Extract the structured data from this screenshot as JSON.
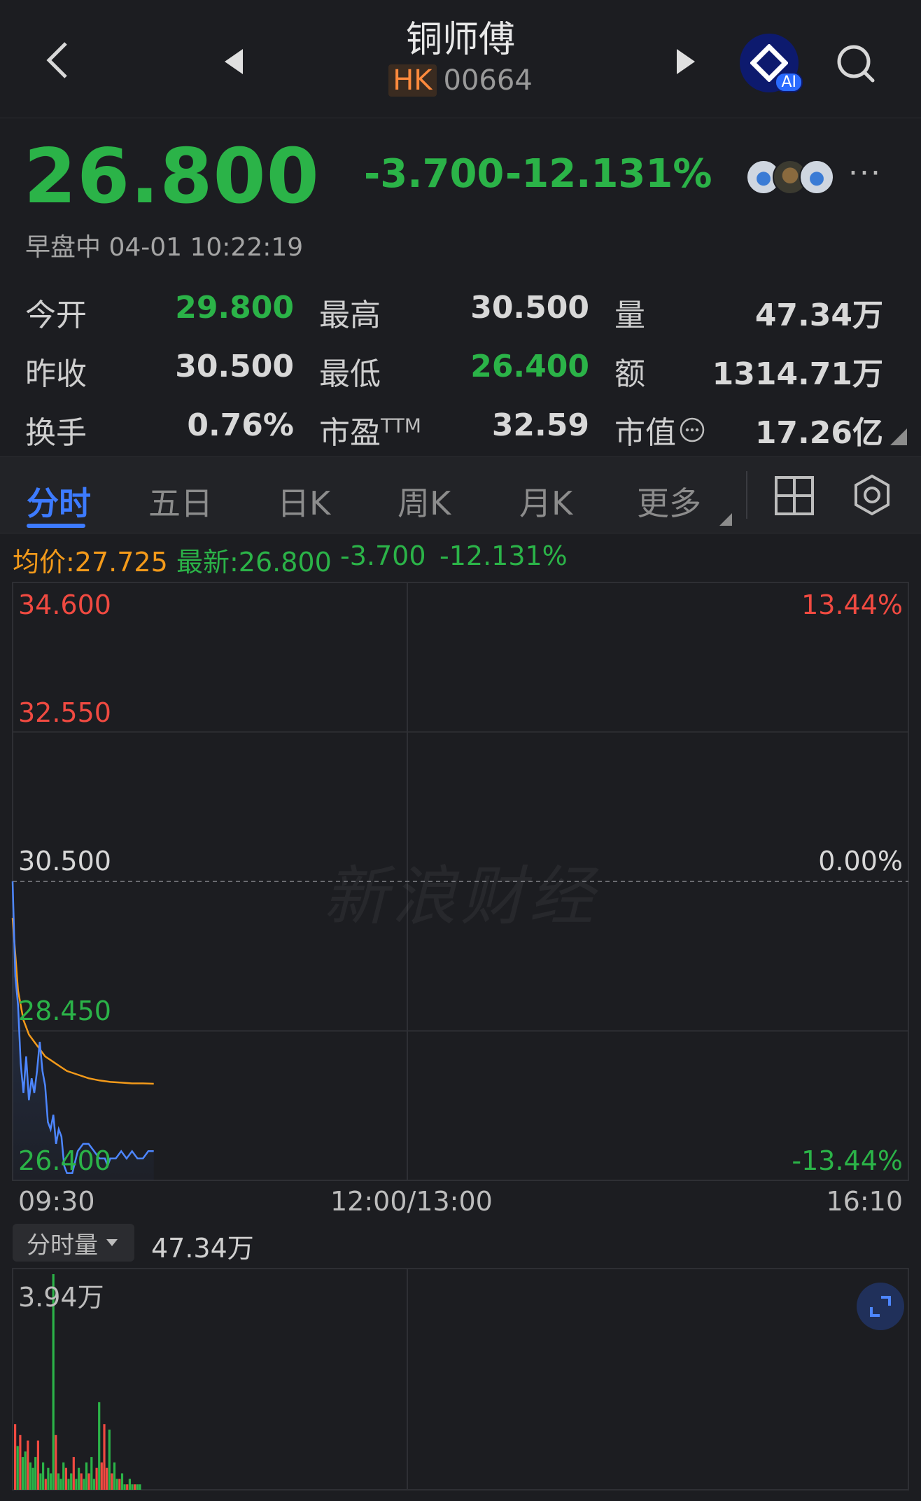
{
  "header": {
    "title": "铜师傅",
    "market": "HK",
    "code": "00664",
    "ai_label": "AI"
  },
  "quote": {
    "price": "26.800",
    "change": "-3.700",
    "change_pct": "-12.131%",
    "session_time": "早盘中 04-01 10:22:19",
    "more": "···"
  },
  "stats": {
    "open_label": "今开",
    "open_value": "29.800",
    "high_label": "最高",
    "high_value": "30.500",
    "volume_label": "量",
    "volume_value": "47.34万",
    "prev_close_label": "昨收",
    "prev_close_value": "30.500",
    "low_label": "最低",
    "low_value": "26.400",
    "amount_label": "额",
    "amount_value": "1314.71万",
    "turnover_label": "换手",
    "turnover_value": "0.76%",
    "pe_label": "市盈",
    "pe_sup": "TTM",
    "pe_value": "32.59",
    "mcap_label": "市值",
    "mcap_value": "17.26亿"
  },
  "tabs": [
    {
      "label": "分时"
    },
    {
      "label": "五日"
    },
    {
      "label": "日K"
    },
    {
      "label": "周K"
    },
    {
      "label": "月K"
    },
    {
      "label": "更多"
    }
  ],
  "info_line": {
    "avg": "均价:27.725",
    "latest": "最新:26.800",
    "change": "-3.700",
    "change_pct": "-12.131%"
  },
  "chart_data": [
    {
      "type": "line",
      "title": "",
      "x_ticks": [
        "09:30",
        "12:00/13:00",
        "16:10"
      ],
      "y_ticks": [
        "34.600",
        "32.550",
        "30.500",
        "28.450",
        "26.400"
      ],
      "y_right_ticks": [
        "13.44%",
        "0.00%",
        "-13.44%"
      ],
      "ylim": [
        26.4,
        34.6
      ],
      "reference_value": 30.5,
      "grid": true,
      "total_minutes": 330,
      "series": [
        {
          "name": "最新",
          "color": "#4d86ff",
          "x": [
            0,
            1,
            2,
            3,
            4,
            5,
            6,
            7,
            8,
            9,
            10,
            11,
            12,
            13,
            14,
            15,
            16,
            17,
            18,
            19,
            20,
            22,
            24,
            26,
            28,
            30,
            32,
            34,
            35,
            36,
            38,
            40,
            42,
            44,
            46,
            48,
            50,
            52
          ],
          "values": [
            30.5,
            29.2,
            28.8,
            28.0,
            27.6,
            28.1,
            27.5,
            27.8,
            27.6,
            27.9,
            28.3,
            27.9,
            27.7,
            27.2,
            27.1,
            27.3,
            26.9,
            27.1,
            27.0,
            26.6,
            26.5,
            26.5,
            26.8,
            26.9,
            26.9,
            26.8,
            26.7,
            26.7,
            26.6,
            26.7,
            26.7,
            26.8,
            26.7,
            26.8,
            26.7,
            26.7,
            26.8,
            26.8
          ]
        },
        {
          "name": "均价",
          "color": "#f39a1a",
          "x": [
            0,
            2,
            4,
            6,
            8,
            10,
            12,
            14,
            16,
            18,
            20,
            24,
            28,
            32,
            36,
            40,
            44,
            48,
            52
          ],
          "values": [
            30.0,
            29.0,
            28.6,
            28.4,
            28.3,
            28.2,
            28.1,
            28.05,
            28.0,
            27.95,
            27.9,
            27.85,
            27.8,
            27.77,
            27.75,
            27.74,
            27.73,
            27.73,
            27.725
          ]
        }
      ]
    },
    {
      "type": "bar",
      "title": "分时量",
      "total": "47.34万",
      "max_label": "3.94万",
      "ymax": 3.94,
      "values": [
        1.2,
        0.8,
        1.0,
        0.6,
        0.7,
        0.9,
        0.5,
        0.4,
        0.6,
        0.9,
        0.3,
        0.5,
        0.2,
        0.4,
        0.3,
        3.94,
        1.0,
        0.3,
        0.2,
        0.5,
        0.4,
        0.2,
        0.3,
        0.6,
        0.2,
        0.4,
        0.3,
        0.2,
        0.5,
        0.3,
        0.6,
        0.2,
        0.4,
        1.6,
        0.5,
        1.2,
        0.4,
        1.1,
        0.3,
        0.5,
        0.2,
        0.2,
        0.3,
        0.1,
        0.1,
        0.2,
        0.1,
        0.1,
        0.1,
        0.1
      ],
      "up": [
        true,
        false,
        true,
        false,
        false,
        true,
        false,
        false,
        false,
        true,
        false,
        false,
        true,
        false,
        false,
        false,
        true,
        false,
        false,
        false,
        true,
        false,
        false,
        true,
        false,
        false,
        true,
        false,
        false,
        true,
        false,
        false,
        true,
        false,
        true,
        true,
        true,
        false,
        true,
        false,
        false,
        true,
        false,
        false,
        true,
        false,
        false,
        true,
        false,
        false
      ]
    }
  ],
  "chart_bottom": {
    "volume_dropdown": "分时量",
    "volume_total": "47.34万",
    "volume_max": "3.94万"
  },
  "watermark": "新浪财经",
  "colors": {
    "down": "#2bb348",
    "up": "#f04a41",
    "price_line": "#4d86ff",
    "avg_line": "#f39a1a",
    "accent": "#3d7bff"
  }
}
